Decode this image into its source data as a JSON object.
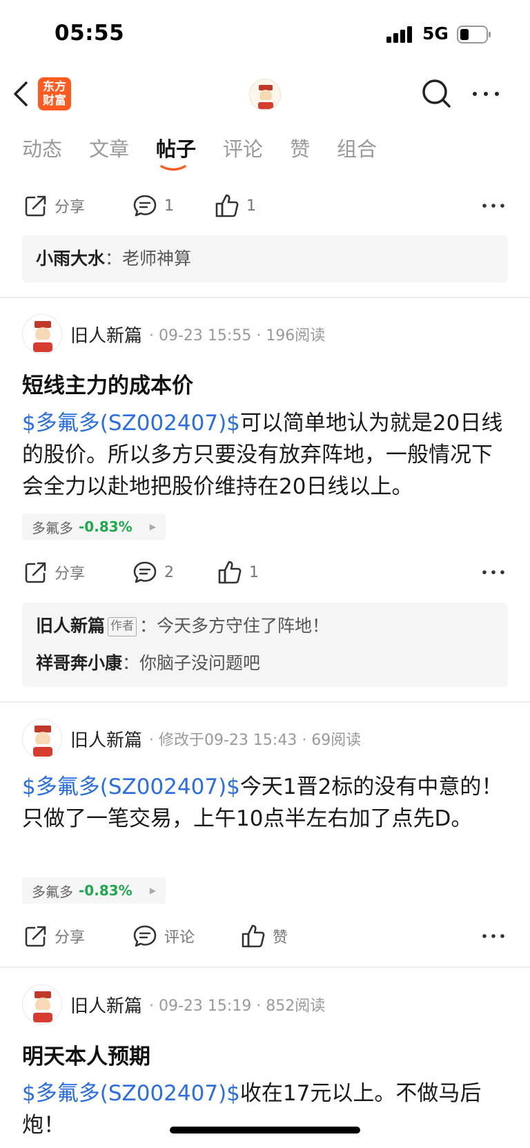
{
  "status": {
    "time": "05:55",
    "network": "5G"
  },
  "nav": {
    "logo_line1": "东方",
    "logo_line2": "财富"
  },
  "tabs": [
    {
      "label": "动态"
    },
    {
      "label": "文章"
    },
    {
      "label": "帖子",
      "active": true
    },
    {
      "label": "评论"
    },
    {
      "label": "赞"
    },
    {
      "label": "组合"
    }
  ],
  "posts": [
    {
      "actions": {
        "share": "分享",
        "comment_count": "1",
        "like_count": "1"
      },
      "comments": [
        {
          "user": "小雨大水",
          "sep": "：",
          "text": "老师神算"
        }
      ]
    },
    {
      "author": "旧人新篇",
      "meta": "· 09-23 15:55 · 196阅读",
      "title": "短线主力的成本价",
      "stock_link": "$多氟多(SZ002407)$",
      "body": "可以简单地认为就是20日线的股价。所以多方只要没有放弃阵地，一般情况下会全力以赴地把股价维持在20日线以上。",
      "chip": {
        "name": "多氟多",
        "change": "-0.83%"
      },
      "actions": {
        "share": "分享",
        "comment_count": "2",
        "like_count": "1"
      },
      "comments": [
        {
          "user": "旧人新篇",
          "tag": "作者",
          "sep": "：",
          "text": "今天多方守住了阵地！"
        },
        {
          "user": "祥哥奔小康",
          "sep": "：",
          "text": "你脑子没问题吧"
        }
      ]
    },
    {
      "author": "旧人新篇",
      "meta": "· 修改于09-23 15:43 · 69阅读",
      "stock_link": "$多氟多(SZ002407)$",
      "body": "今天1晋2标的没有中意的！只做了一笔交易，上午10点半左右加了点先D。",
      "chip": {
        "name": "多氟多",
        "change": "-0.83%"
      },
      "actions": {
        "share": "分享",
        "comment": "评论",
        "like": "赞"
      }
    },
    {
      "author": "旧人新篇",
      "meta": "· 09-23 15:19 · 852阅读",
      "title": "明天本人预期",
      "stock_link": "$多氟多(SZ002407)$",
      "body": "收在17元以上。不做马后炮！"
    }
  ],
  "colors": {
    "brand": "#ff5a1f",
    "link": "#2a6ee0",
    "down": "#1ea94f"
  }
}
